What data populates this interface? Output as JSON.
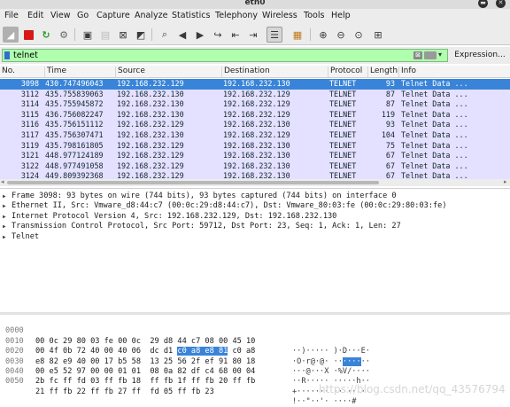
{
  "window": {
    "title": "eth0"
  },
  "menu": [
    "File",
    "Edit",
    "View",
    "Go",
    "Capture",
    "Analyze",
    "Statistics",
    "Telephony",
    "Wireless",
    "Tools",
    "Help"
  ],
  "toolbar": [
    "shark-fin-icon",
    "stop-icon",
    "restart-icon",
    "options-icon",
    "open-icon",
    "save-icon",
    "close-file-icon",
    "reload-icon",
    "find-icon",
    "back-icon",
    "forward-icon",
    "goto-icon",
    "first-icon",
    "last-icon",
    "autoscroll-icon",
    "colorize-icon",
    "zoom-in-icon",
    "zoom-out-icon",
    "zoom-normal-icon",
    "resize-columns-icon"
  ],
  "filter": {
    "value": "telnet",
    "clear_symbol": "⊠",
    "expression_label": "Expression..."
  },
  "packet_list": {
    "columns": [
      "No.",
      "Time",
      "Source",
      "Destination",
      "Protocol",
      "Length",
      "Info"
    ],
    "rows": [
      {
        "no": "3098",
        "time": "430.747496043",
        "src": "192.168.232.129",
        "dst": "192.168.232.130",
        "proto": "TELNET",
        "len": "93",
        "info": "Telnet Data ..."
      },
      {
        "no": "3112",
        "time": "435.755839063",
        "src": "192.168.232.130",
        "dst": "192.168.232.129",
        "proto": "TELNET",
        "len": "87",
        "info": "Telnet Data ..."
      },
      {
        "no": "3114",
        "time": "435.755945872",
        "src": "192.168.232.130",
        "dst": "192.168.232.129",
        "proto": "TELNET",
        "len": "87",
        "info": "Telnet Data ..."
      },
      {
        "no": "3115",
        "time": "436.756082247",
        "src": "192.168.232.130",
        "dst": "192.168.232.129",
        "proto": "TELNET",
        "len": "119",
        "info": "Telnet Data ..."
      },
      {
        "no": "3116",
        "time": "435.756151112",
        "src": "192.168.232.129",
        "dst": "192.168.232.130",
        "proto": "TELNET",
        "len": "93",
        "info": "Telnet Data ..."
      },
      {
        "no": "3117",
        "time": "435.756307471",
        "src": "192.168.232.130",
        "dst": "192.168.232.129",
        "proto": "TELNET",
        "len": "104",
        "info": "Telnet Data ..."
      },
      {
        "no": "3119",
        "time": "435.798161805",
        "src": "192.168.232.129",
        "dst": "192.168.232.130",
        "proto": "TELNET",
        "len": "75",
        "info": "Telnet Data ..."
      },
      {
        "no": "3121",
        "time": "448.977124189",
        "src": "192.168.232.129",
        "dst": "192.168.232.130",
        "proto": "TELNET",
        "len": "67",
        "info": "Telnet Data ..."
      },
      {
        "no": "3122",
        "time": "448.977491058",
        "src": "192.168.232.129",
        "dst": "192.168.232.130",
        "proto": "TELNET",
        "len": "67",
        "info": "Telnet Data ..."
      },
      {
        "no": "3124",
        "time": "449.809392368",
        "src": "192.168.232.129",
        "dst": "192.168.232.130",
        "proto": "TELNET",
        "len": "67",
        "info": "Telnet Data ..."
      }
    ]
  },
  "details": [
    "Frame 3098: 93 bytes on wire (744 bits), 93 bytes captured (744 bits) on interface 0",
    "Ethernet II, Src: Vmware_d8:44:c7 (00:0c:29:d8:44:c7), Dst: Vmware_80:03:fe (00:0c:29:80:03:fe)",
    "Internet Protocol Version 4, Src: 192.168.232.129, Dst: 192.168.232.130",
    "Transmission Control Protocol, Src Port: 59712, Dst Port: 23, Seq: 1, Ack: 1, Len: 27",
    "Telnet"
  ],
  "bytes": [
    {
      "off": "0000",
      "hex": "00 0c 29 80 03 fe 00 0c  29 d8 44 c7 08 00 45 10",
      "ascii": "··)····· )·D···E·"
    },
    {
      "off": "0010",
      "hex_pre": "00 4f 0b 72 40 00 40 06  dc d1 ",
      "hex_hl": "c0 a8 e8 81",
      "hex_post": " c0 a8",
      "ascii_pre": "·O·r@·@· ··",
      "ascii_hl": "····",
      "ascii_post": "··"
    },
    {
      "off": "0020",
      "hex": "e8 82 e9 40 00 17 b5 58  13 25 56 2f ef 91 80 18",
      "ascii": "···@···X ·%V/····"
    },
    {
      "off": "0030",
      "hex": "00 e5 52 97 00 00 01 01  08 0a 82 df c4 68 00 04",
      "ascii": "··R····· ·····h··"
    },
    {
      "off": "0040",
      "hex": "2b fc ff fd 03 ff fb 18  ff fb 1f ff fb 20 ff fb",
      "ascii": "+······· ····· ··"
    },
    {
      "off": "0050",
      "hex": "21 ff fb 22 ff fb 27 ff  fd 05 ff fb 23",
      "ascii": "!··\"··'· ····#"
    }
  ],
  "watermark": "https://blog.csdn.net/qq_43576794",
  "colors": {
    "selected_row": "#3984d8",
    "row_bg": "#e4e0ff",
    "filter_ok": "#afffaf"
  }
}
